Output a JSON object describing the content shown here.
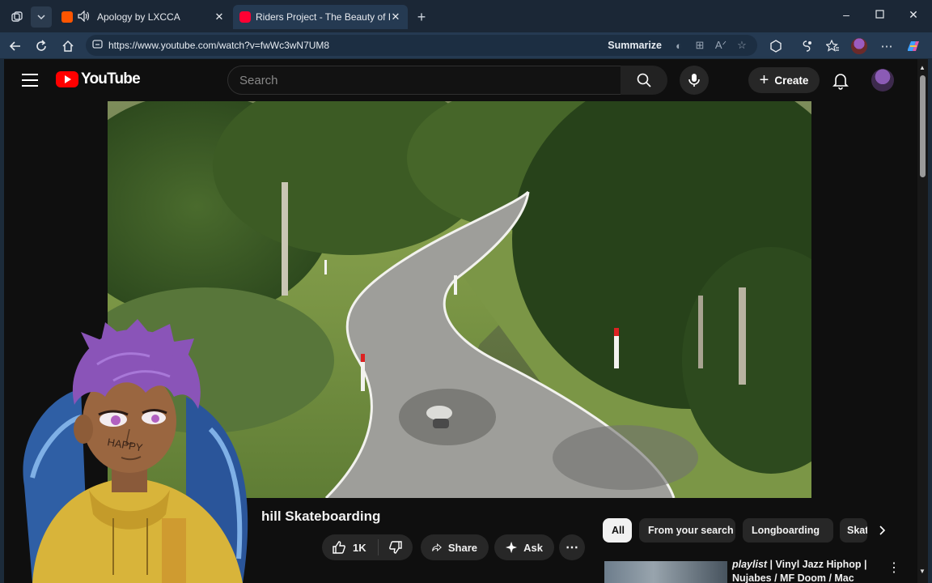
{
  "browser": {
    "tabs": [
      {
        "title": "Apology by LXCCA",
        "favicon_color": "#ff5500",
        "audio": true,
        "active": false
      },
      {
        "title": "Riders Project - The Beauty of Do",
        "favicon_color": "#ff0033",
        "audio": false,
        "active": true
      }
    ],
    "url": "https://www.youtube.com/watch?v=fwWc3wN7UM8",
    "summarize_label": "Summarize"
  },
  "youtube": {
    "logo_text": "YouTube",
    "search_placeholder": "Search",
    "create_label": "Create",
    "video_title_visible": "hill Skateboarding",
    "like_count": "1K",
    "share_label": "Share",
    "ask_label": "Ask",
    "chips": [
      "All",
      "From your search",
      "Longboarding",
      "Skat"
    ],
    "recommendation": {
      "title_italic": "playlist",
      "title_rest": " | Vinyl Jazz Hiphop | Nujabes / MF Doom / Mac"
    }
  },
  "overlay": {
    "face_text": "HAPPY"
  },
  "colors": {
    "accent_red": "#ff0000",
    "page_bg": "#0f0f0f",
    "browser_chrome": "#1b2736"
  }
}
